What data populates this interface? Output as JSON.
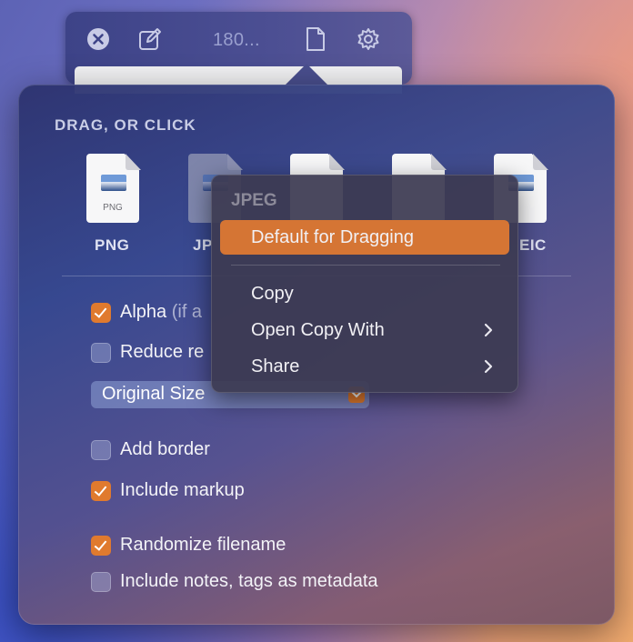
{
  "toolbar": {
    "title": "180...",
    "icons": [
      "close-icon",
      "edit-icon",
      "document-icon",
      "gear-icon"
    ]
  },
  "popover": {
    "section_title": "DRAG, OR CLICK",
    "files": [
      {
        "ext": "PNG",
        "label": "PNG"
      },
      {
        "ext": "JPEG",
        "label": "JP"
      },
      {
        "ext": "",
        "label": ""
      },
      {
        "ext": "",
        "label": ""
      },
      {
        "ext": "EIC",
        "label": "EIC"
      }
    ],
    "options": {
      "alpha": {
        "label": "Alpha",
        "hint": "(if a",
        "checked": true
      },
      "reduce": {
        "label": "Reduce re",
        "checked": false
      },
      "size_select": {
        "value": "Original Size"
      },
      "add_border": {
        "label": "Add border",
        "checked": false
      },
      "include_markup": {
        "label": "Include markup",
        "checked": true
      },
      "randomize_filename": {
        "label": "Randomize filename",
        "checked": true
      },
      "include_notes": {
        "label": "Include notes, tags as metadata",
        "checked": false
      }
    }
  },
  "context_menu": {
    "header": "JPEG",
    "items": {
      "default_drag": "Default for Dragging",
      "copy": "Copy",
      "open_copy_with": "Open Copy With",
      "share": "Share"
    }
  },
  "colors": {
    "accent": "#e07a2e",
    "menu_highlight": "#d57534"
  }
}
